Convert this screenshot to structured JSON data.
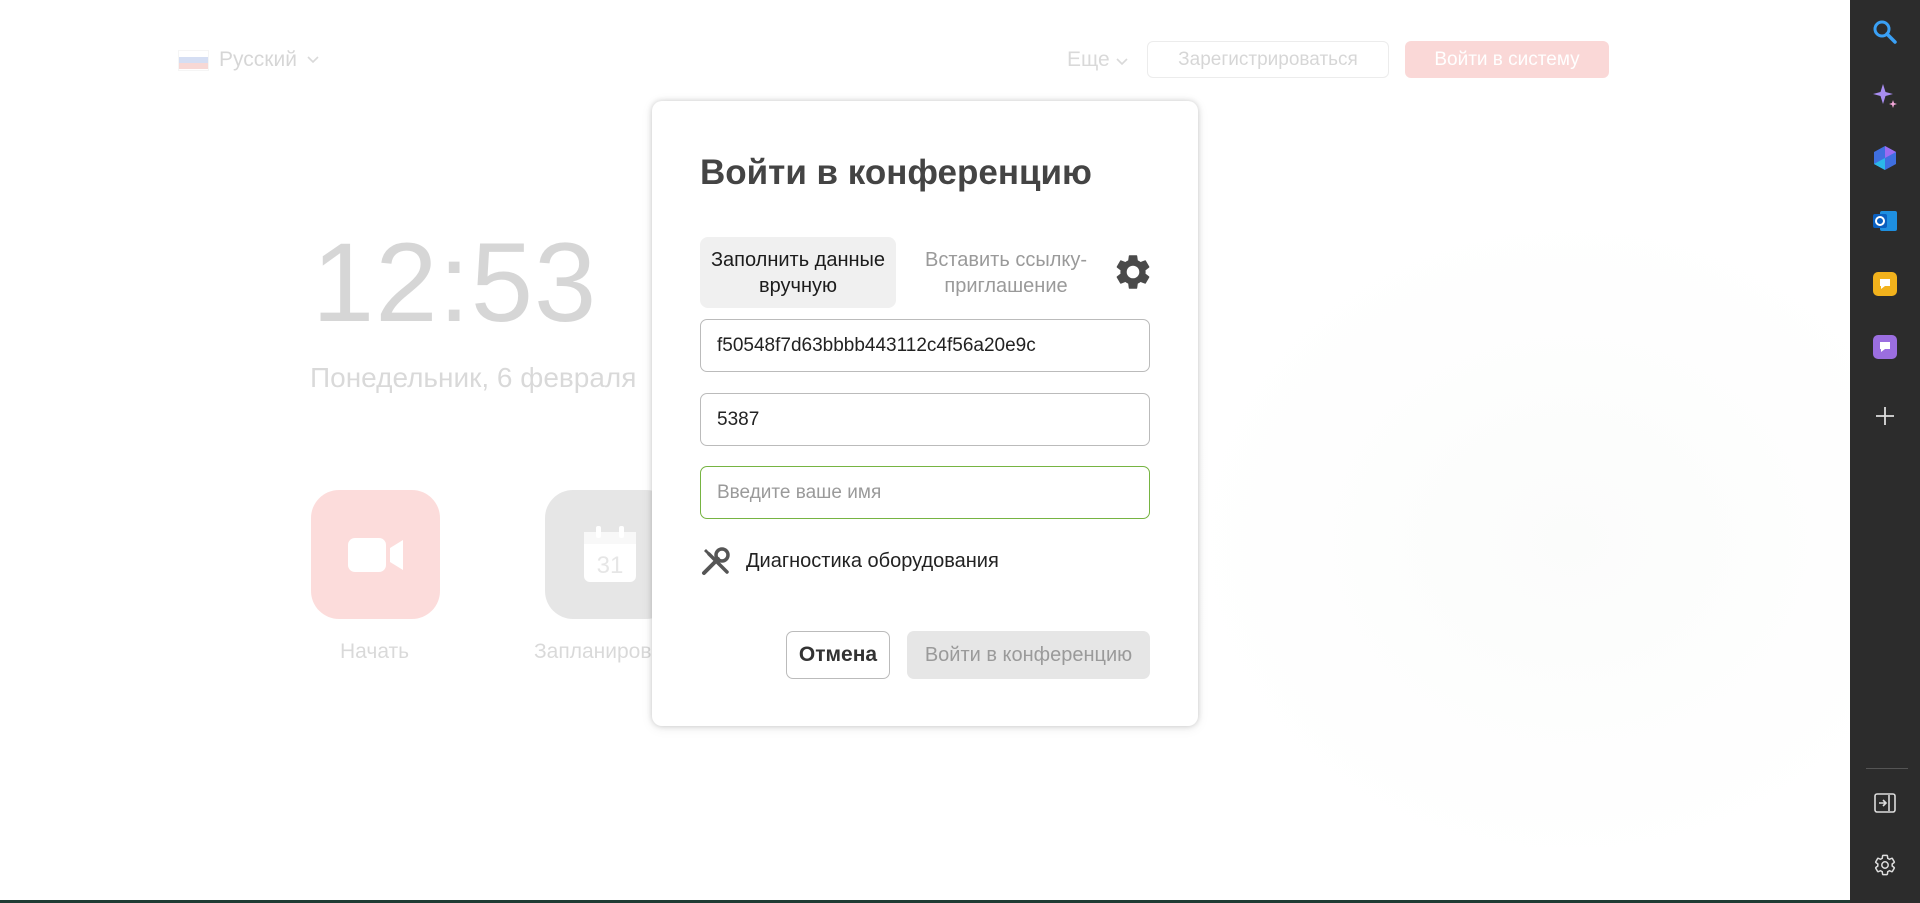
{
  "header": {
    "language": "Русский",
    "more": "Еще",
    "register": "Зарегистрироваться",
    "login": "Войти в систему"
  },
  "home": {
    "time": "12:53",
    "date": "Понедельник, 6 февраля",
    "start_label": "Начать",
    "schedule_label": "Запланиров",
    "calendar_day": "31"
  },
  "dialog": {
    "title": "Войти в конференцию",
    "tabs": [
      {
        "label": "Заполнить данные вручную",
        "active": true
      },
      {
        "label": "Вставить ссылку-приглашение",
        "active": false
      }
    ],
    "conference_id": "f50548f7d63bbbb443112c4f56a20e9c",
    "password": "5387",
    "name_placeholder": "Введите ваше имя",
    "diagnostics": "Диагностика оборудования",
    "cancel": "Отмена",
    "join": "Войти в конференцию"
  },
  "sidebar": {
    "icons": [
      "search-icon",
      "copilot-sparkle-icon",
      "microsoft-365-icon",
      "outlook-icon",
      "yellow-chat-icon",
      "purple-chat-icon",
      "add-icon",
      "exit-panel-icon",
      "settings-icon"
    ]
  },
  "colors": {
    "accent_red": "#e8302a",
    "valid_green": "#76b442",
    "sidebar_bg": "#2c2c2c"
  }
}
